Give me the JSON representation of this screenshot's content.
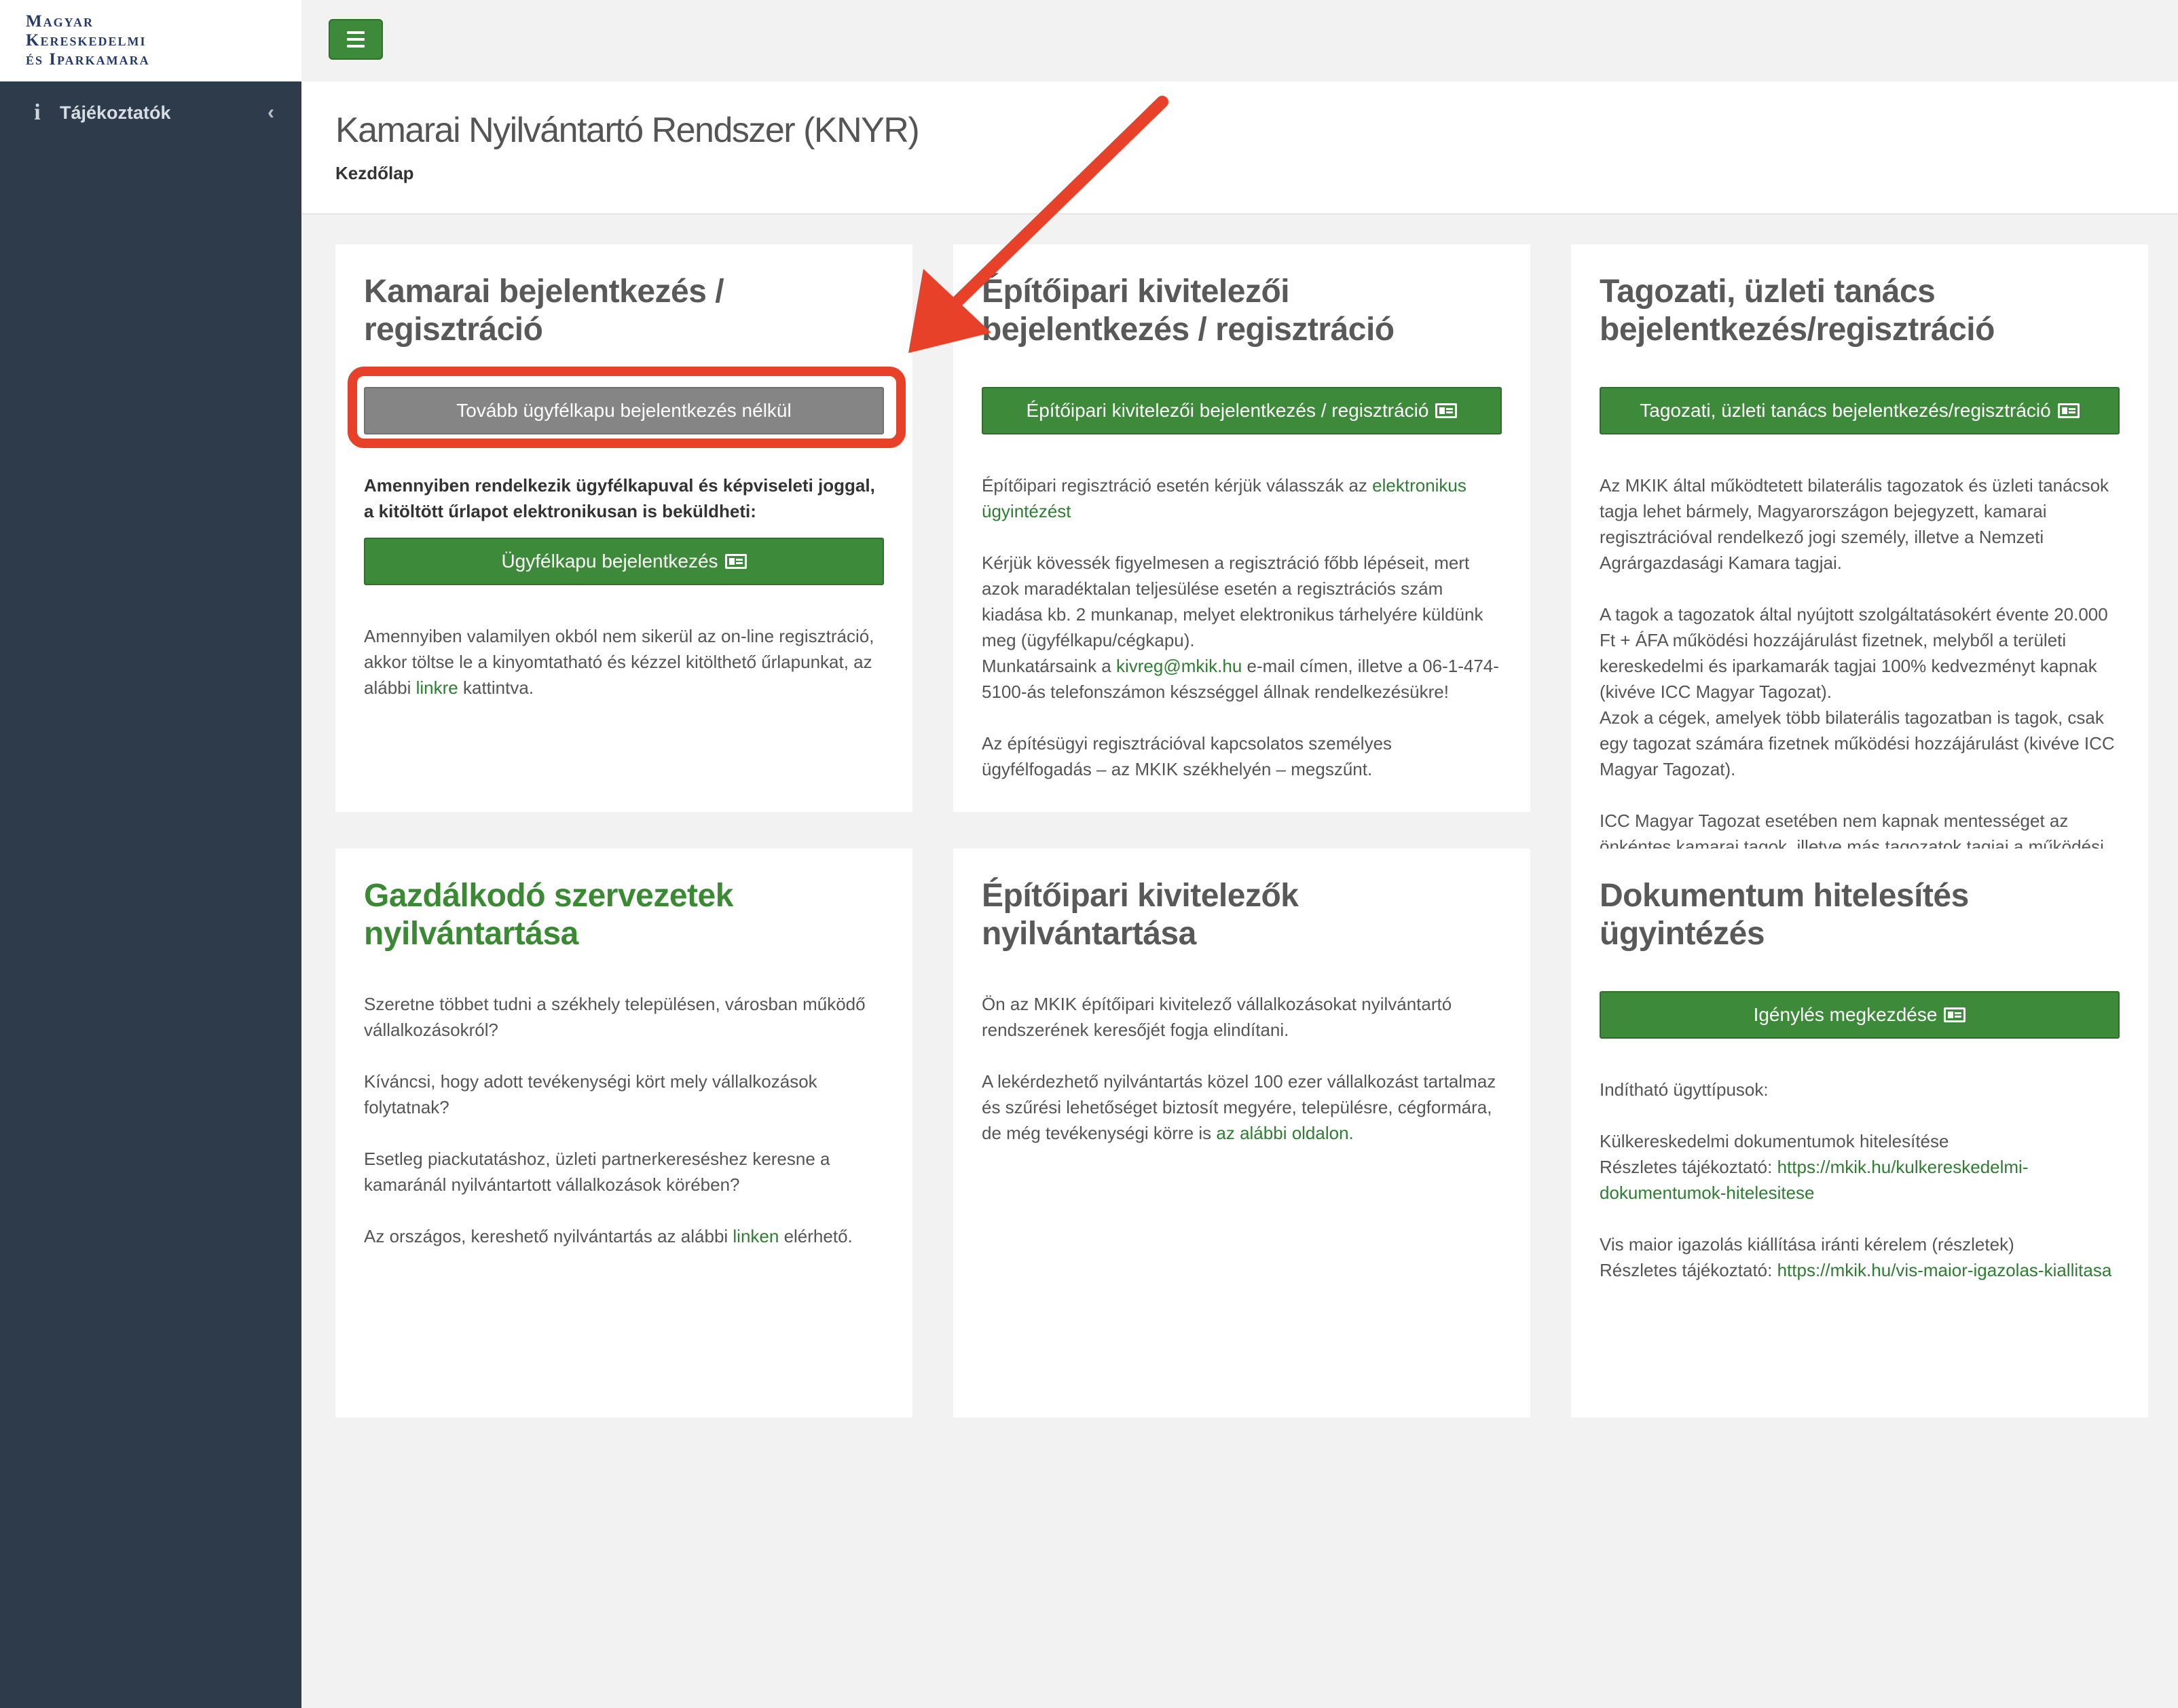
{
  "logo": {
    "line1": "Magyar",
    "line2": "Kereskedelmi",
    "line3": "és Iparkamara"
  },
  "sidebar": {
    "items": [
      {
        "label": "Tájékoztatók",
        "icon": "info-icon",
        "chevron": "chevron-left-icon"
      }
    ]
  },
  "topbar": {
    "menu_icon": "hamburger-icon"
  },
  "header": {
    "title": "Kamarai Nyilvántartó Rendszer (KNYR)",
    "breadcrumb": "Kezdőlap"
  },
  "cards": {
    "c1": {
      "title": "Kamarai bejelentkezés / regisztráció",
      "button_gray": "Tovább ügyfélkapu bejelentkezés nélkül",
      "bold_text": "Amennyiben rendelkezik ügyfélkapuval és képviseleti joggal, a kitöltött űrlapot elektronikusan is beküldheti:",
      "button_green": "Ügyfélkapu bejelentkezés",
      "text_before_link": "Amennyiben valamilyen okból nem sikerül az on-line regisztráció, akkor töltse le a kinyomtatható és kézzel kitölthető űrlapunkat, az alábbi ",
      "link": "linkre",
      "text_after_link": " kattintva."
    },
    "c2": {
      "title": "Építőipari kivitelezői bejelentkezés / regisztráció",
      "button": "Építőipari kivitelezői bejelentkezés / regisztráció",
      "p1_text": "Építőipari regisztráció esetén kérjük válasszák az ",
      "p1_link": "elektronikus ügyintézést",
      "p2_text1": "Kérjük kövessék figyelmesen a regisztráció főbb lépéseit, mert azok maradéktalan teljesülése esetén a regisztrációs szám kiadása kb. 2 munkanap, melyet elektronikus tárhelyére küldünk meg (ügyfélkapu/cégkapu).",
      "p2_text2": "Munkatársaink a ",
      "p2_link": "kivreg@mkik.hu",
      "p2_text3": " e-mail címen, illetve a 06-1-474-5100-ás telefonszámon készséggel állnak rendelkezésükre!",
      "p3": "Az építésügyi regisztrációval kapcsolatos személyes ügyfélfogadás – az MKIK székhelyén – megszűnt."
    },
    "c3": {
      "title": "Tagozati, üzleti tanács bejelentkezés/regisztráció",
      "button": "Tagozati, üzleti tanács bejelentkezés/regisztráció",
      "p1": "Az MKIK által működtetett bilaterális tagozatok és üzleti tanácsok tagja lehet bármely, Magyarországon bejegyzett, kamarai regisztrációval rendelkező jogi személy, illetve a Nemzeti Agrárgazdasági Kamara tagjai.",
      "p2a": "A tagok a tagozatok által nyújtott szolgáltatásokért évente 20.000 Ft + ÁFA működési hozzájárulást fizetnek, melyből a területi kereskedelmi és iparkamarák tagjai 100% kedvezményt kapnak (kivéve ICC Magyar Tagozat).",
      "p2b": "Azok a cégek, amelyek több bilaterális tagozatban is tagok, csak egy tagozat számára fizetnek működési hozzájárulást (kivéve ICC Magyar Tagozat).",
      "p3": "ICC Magyar Tagozat esetében nem kapnak mentességet az önkéntes kamarai tagok, illetve más tagozatok tagjai a működési"
    },
    "c4": {
      "title": "Gazdálkodó szervezetek nyilvántartása",
      "p1": "Szeretne többet tudni a székhely településen, városban működő vállalkozásokról?",
      "p2": "Kíváncsi, hogy adott tevékenységi kört mely vállalkozások folytatnak?",
      "p3": "Esetleg piackutatáshoz, üzleti partnerkereséshez keresne a kamaránál nyilvántartott vállalkozások körében?",
      "p4_text": "Az országos, kereshető nyilvántartás az alábbi ",
      "p4_link": "linken",
      "p4_after": " elérhető."
    },
    "c5": {
      "title": "Építőipari kivitelezők nyilvántartása",
      "p1": "Ön az MKIK építőipari kivitelező vállalkozásokat nyilvántartó rendszerének keresőjét fogja elindítani.",
      "p2_text": "A lekérdezhető nyilvántartás közel 100 ezer vállalkozást tartalmaz és szűrési lehetőséget biztosít megyére, településre, cégformára, de még tevékenységi körre is ",
      "p2_link": "az alábbi oldalon."
    },
    "c6": {
      "title": "Dokumentum hitelesítés ügyintézés",
      "button": "Igénylés megkezdése",
      "p1": "Indítható ügyttípusok:",
      "p2_line1": "Külkereskedelmi dokumentumok hitelesítése",
      "p2_label": "Részletes tájékoztató: ",
      "p2_link": "https://mkik.hu/kulkereskedelmi-dokumentumok-hitelesitese",
      "p3_line1": "Vis maior igazolás kiállítása iránti kérelem (részletek)",
      "p3_label": "Részletes tájékoztató: ",
      "p3_link": "https://mkik.hu/vis-maior-igazolas-kiallitasa"
    }
  },
  "colors": {
    "sidebar": "#2e3b4b",
    "accent_green": "#3d8a3a",
    "gray_button": "#858585",
    "annotation_red": "#e8412a"
  }
}
